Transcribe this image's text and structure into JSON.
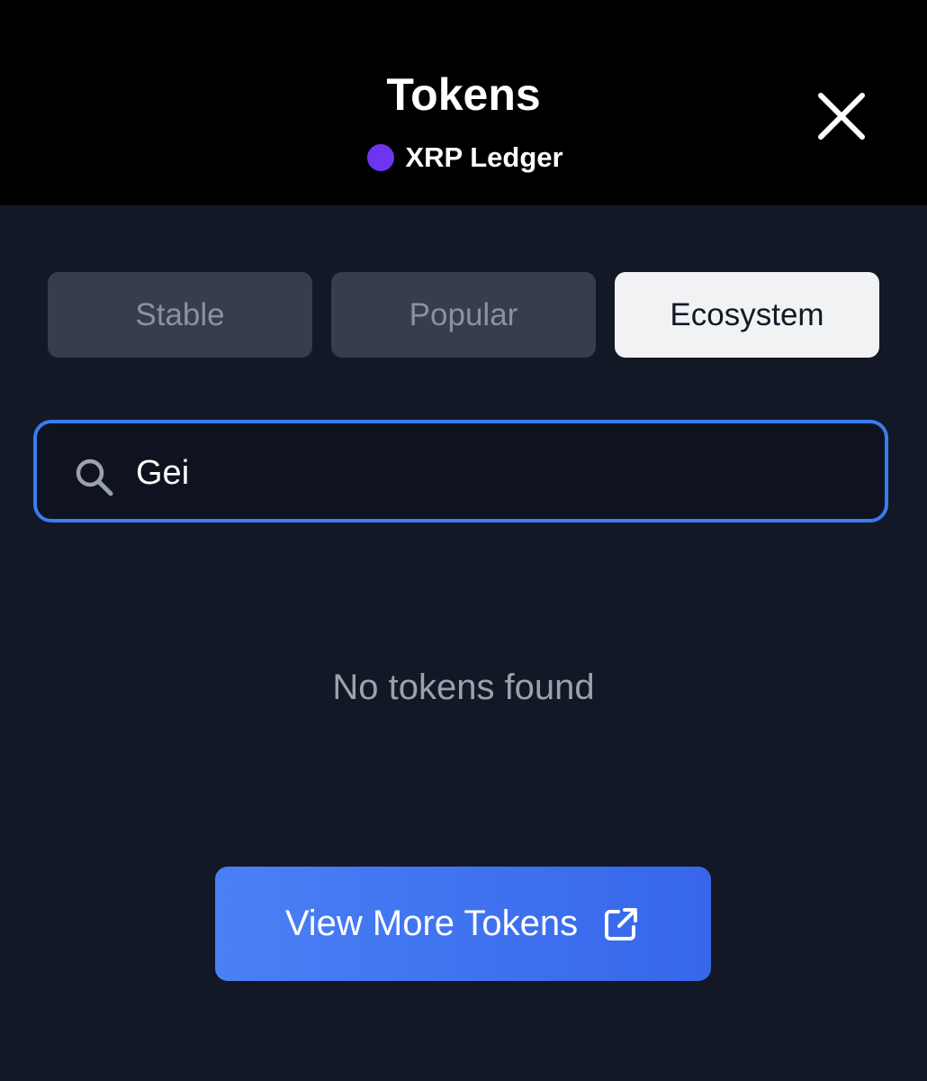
{
  "header": {
    "title": "Tokens",
    "network": {
      "name": "XRP Ledger",
      "dot_color": "#6d35f2"
    },
    "close_icon": "close-icon"
  },
  "tabs": [
    {
      "label": "Stable",
      "active": false
    },
    {
      "label": "Popular",
      "active": false
    },
    {
      "label": "Ecosystem",
      "active": true
    }
  ],
  "search": {
    "icon": "search-icon",
    "value": "Gei"
  },
  "empty_state": {
    "message": "No tokens found"
  },
  "view_more": {
    "label": "View More Tokens",
    "icon": "external-link-icon"
  },
  "colors": {
    "background": "#131826",
    "header_background": "#000000",
    "accent": "#3b7cf0",
    "tab_inactive": "#373d4d",
    "tab_active": "#f1f2f4"
  }
}
